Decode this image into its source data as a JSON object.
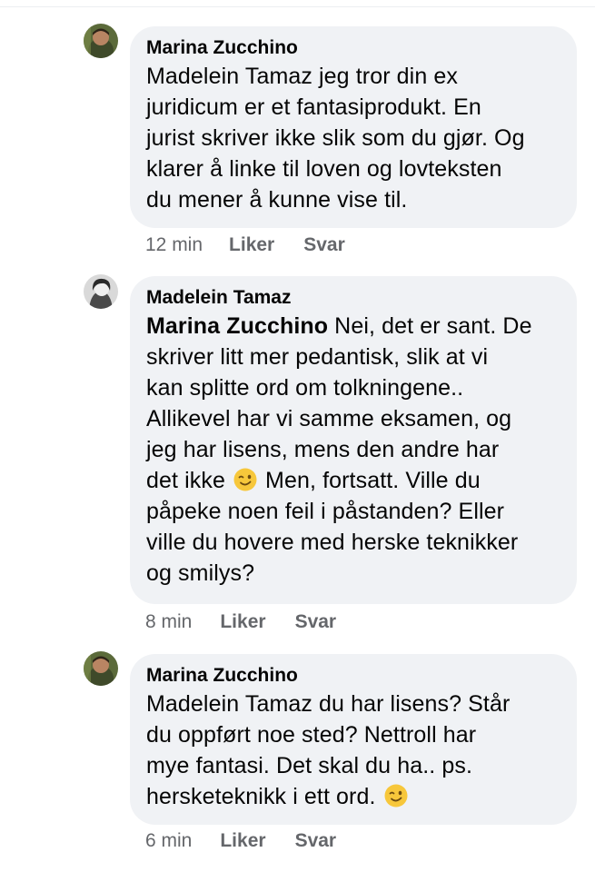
{
  "comments": [
    {
      "author": "Marina Zucchino",
      "text_lines": [
        "Madelein Tamaz jeg tror din ex",
        "juridicum er et fantasiprodukt. En",
        "jurist skriver ikke slik som du gjør. Og",
        "klarer å linke til loven og lovteksten",
        "du mener å kunne vise til."
      ],
      "time": "12 min",
      "like_label": "Liker",
      "reply_label": "Svar"
    },
    {
      "author": "Madelein Tamaz",
      "mention": "Marina Zucchino",
      "text_line_1": " Nei, det er sant. De",
      "text_lines": [
        "skriver litt mer pedantisk, slik at vi",
        "kan splitte ord om tolkningene..",
        "Allikevel har vi samme eksamen, og",
        "jeg har lisens, mens den andre har"
      ],
      "text_before_emoji": "det ikke",
      "text_after_emoji": " Men, fortsatt. Ville du",
      "text_lines_after": [
        "påpeke noen feil i påstanden? Eller",
        "ville du hovere med herske teknikker",
        "og smilys?"
      ],
      "time": "8 min",
      "like_label": "Liker",
      "reply_label": "Svar"
    },
    {
      "author": "Marina Zucchino",
      "text_lines": [
        "Madelein Tamaz du har lisens? Står",
        "du oppført noe sted?  Nettroll har",
        "mye fantasi. Det skal du ha.. ps."
      ],
      "text_before_emoji": "hersketeknikk i ett ord.",
      "time": "6 min",
      "like_label": "Liker",
      "reply_label": "Svar"
    }
  ],
  "colors": {
    "bubble": "#f0f2f5",
    "text": "#050505",
    "meta": "#65676b",
    "emoji": "#f7c73b"
  },
  "icons": {
    "emoji": "winking-face-emoji"
  }
}
